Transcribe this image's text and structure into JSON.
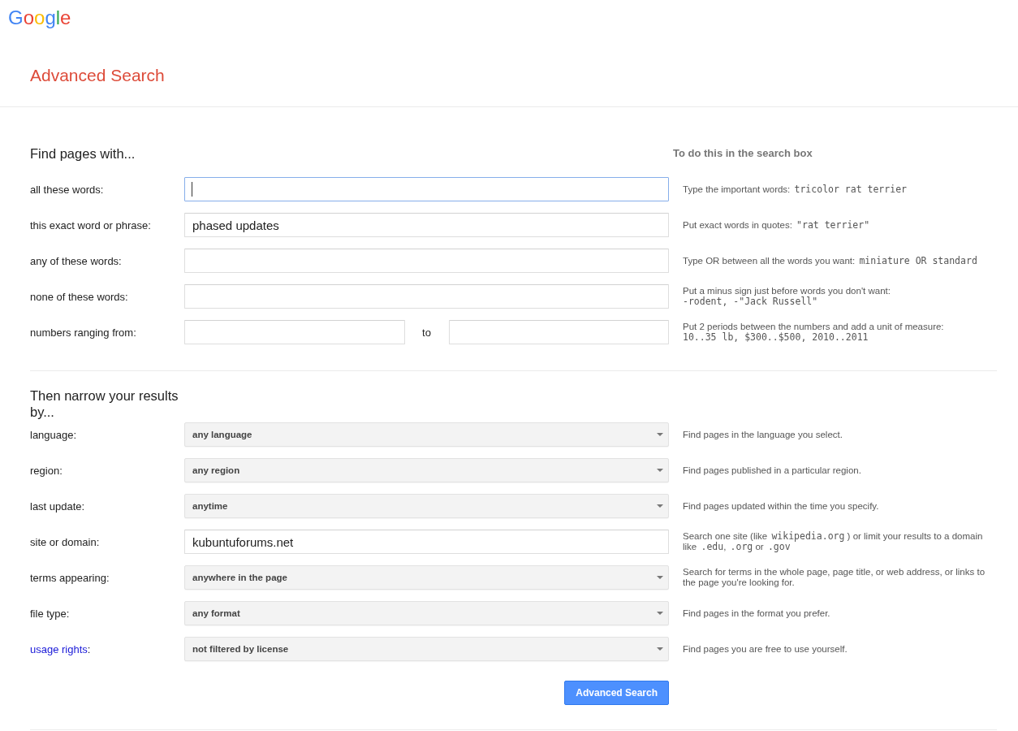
{
  "logo": "Google",
  "page_title": "Advanced Search",
  "sections": [
    {
      "heading": "Find pages with...",
      "hint_heading": "To do this in the search box",
      "rows": [
        {
          "kind": "text",
          "label": "all these words:",
          "label_link": false,
          "focused": true,
          "hint": [
            [
              {
                "kind": "text",
                "text": "Type the important words: "
              },
              {
                "kind": "code",
                "text": "tricolor rat terrier"
              }
            ]
          ]
        },
        {
          "kind": "text",
          "label": "this exact word or phrase:",
          "label_link": false,
          "focused": false,
          "value": "phased updates",
          "hint": [
            [
              {
                "kind": "text",
                "text": "Put exact words in quotes: "
              },
              {
                "kind": "code",
                "text": "\"rat terrier\""
              }
            ]
          ]
        },
        {
          "kind": "text",
          "label": "any of these words:",
          "label_link": false,
          "focused": false,
          "hint": [
            [
              {
                "kind": "text",
                "text": "Type OR between all the words you want: "
              },
              {
                "kind": "code",
                "text": "miniature OR standard"
              }
            ]
          ]
        },
        {
          "kind": "text",
          "label": "none of these words:",
          "label_link": false,
          "focused": false,
          "hint": [
            [
              {
                "kind": "text",
                "text": "Put a minus sign just before words you don't want:"
              }
            ],
            [
              {
                "kind": "code",
                "text": "-rodent, -\"Jack Russell\""
              }
            ]
          ]
        },
        {
          "kind": "range",
          "label": "numbers ranging from:",
          "label_link": false,
          "focused": false,
          "separator": "to",
          "hint": [
            [
              {
                "kind": "text",
                "text": "Put 2 periods between the numbers and add a unit of measure:"
              }
            ],
            [
              {
                "kind": "code",
                "text": "10..35 lb, $300..$500, 2010..2011"
              }
            ]
          ]
        }
      ]
    },
    {
      "heading": "Then narrow your results by...",
      "rows": [
        {
          "kind": "select",
          "label": "language:",
          "label_link": false,
          "value": "any language",
          "hint": [
            [
              {
                "kind": "text",
                "text": "Find pages in the language you select."
              }
            ]
          ]
        },
        {
          "kind": "select",
          "label": "region:",
          "label_link": false,
          "value": "any region",
          "hint": [
            [
              {
                "kind": "text",
                "text": "Find pages published in a particular region."
              }
            ]
          ]
        },
        {
          "kind": "select",
          "label": "last update:",
          "label_link": false,
          "value": "anytime",
          "hint": [
            [
              {
                "kind": "text",
                "text": "Find pages updated within the time you specify."
              }
            ]
          ]
        },
        {
          "kind": "text",
          "label": "site or domain:",
          "label_link": false,
          "focused": false,
          "value": "kubuntuforums.net",
          "hint": [
            [
              {
                "kind": "text",
                "text": "Search one site (like "
              },
              {
                "kind": "code",
                "text": "wikipedia.org"
              },
              {
                "kind": "text",
                "text": " ) or limit your results to a domain like "
              },
              {
                "kind": "code",
                "text": ".edu"
              },
              {
                "kind": "text",
                "text": ", "
              },
              {
                "kind": "code",
                "text": ".org"
              },
              {
                "kind": "text",
                "text": " or "
              },
              {
                "kind": "code",
                "text": ".gov"
              }
            ]
          ]
        },
        {
          "kind": "select",
          "label": "terms appearing:",
          "label_link": false,
          "value": "anywhere in the page",
          "hint": [
            [
              {
                "kind": "text",
                "text": "Search for terms in the whole page, page title, or web address, or links to the page you're looking for."
              }
            ]
          ]
        },
        {
          "kind": "select",
          "label": "file type:",
          "label_link": false,
          "value": "any format",
          "hint": [
            [
              {
                "kind": "text",
                "text": "Find pages in the format you prefer."
              }
            ]
          ]
        },
        {
          "kind": "select",
          "label": "usage rights",
          "label_suffix": ":",
          "label_link": true,
          "value": "not filtered by license",
          "hint": [
            [
              {
                "kind": "text",
                "text": "Find pages you are free to use yourself."
              }
            ]
          ]
        }
      ],
      "button": "Advanced Search"
    }
  ]
}
